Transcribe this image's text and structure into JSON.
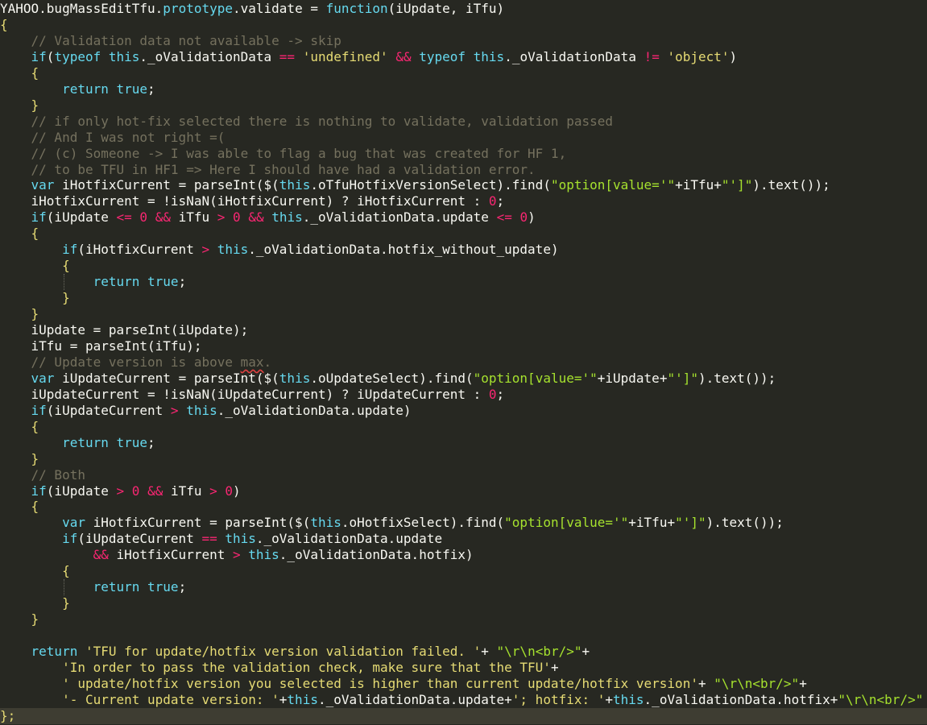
{
  "editor": {
    "lines": [
      {
        "tokens": [
          {
            "t": "YAHOO.bugMassEditTfu.",
            "c": "plain"
          },
          {
            "t": "prototype",
            "c": "proto"
          },
          {
            "t": ".validate = ",
            "c": "plain"
          },
          {
            "t": "function",
            "c": "kw"
          },
          {
            "t": "(iUpdate, iTfu)",
            "c": "plain"
          }
        ]
      },
      {
        "tokens": [
          {
            "t": "{",
            "c": "brace"
          }
        ]
      },
      {
        "tokens": [
          {
            "t": "    // Validation data not available -> skip",
            "c": "cmt"
          }
        ]
      },
      {
        "tokens": [
          {
            "t": "    ",
            "c": "plain"
          },
          {
            "t": "if",
            "c": "kw"
          },
          {
            "t": "(",
            "c": "plain"
          },
          {
            "t": "typeof",
            "c": "kw"
          },
          {
            "t": " ",
            "c": "plain"
          },
          {
            "t": "this",
            "c": "this"
          },
          {
            "t": "._oValidationData ",
            "c": "plain"
          },
          {
            "t": "==",
            "c": "op"
          },
          {
            "t": " ",
            "c": "plain"
          },
          {
            "t": "'undefined'",
            "c": "str"
          },
          {
            "t": " ",
            "c": "plain"
          },
          {
            "t": "&&",
            "c": "op"
          },
          {
            "t": " ",
            "c": "plain"
          },
          {
            "t": "typeof",
            "c": "kw"
          },
          {
            "t": " ",
            "c": "plain"
          },
          {
            "t": "this",
            "c": "this"
          },
          {
            "t": "._oValidationData ",
            "c": "plain"
          },
          {
            "t": "!=",
            "c": "op"
          },
          {
            "t": " ",
            "c": "plain"
          },
          {
            "t": "'object'",
            "c": "str"
          },
          {
            "t": ")",
            "c": "plain"
          }
        ]
      },
      {
        "tokens": [
          {
            "t": "    {",
            "c": "brace"
          }
        ]
      },
      {
        "tokens": [
          {
            "t": "        ",
            "c": "plain"
          },
          {
            "t": "return",
            "c": "kw"
          },
          {
            "t": " ",
            "c": "plain"
          },
          {
            "t": "true",
            "c": "kw"
          },
          {
            "t": ";",
            "c": "plain"
          }
        ]
      },
      {
        "tokens": [
          {
            "t": "    }",
            "c": "brace"
          }
        ]
      },
      {
        "tokens": [
          {
            "t": "    // if only hot-fix selected there is nothing to validate, validation passed",
            "c": "cmt"
          }
        ]
      },
      {
        "tokens": [
          {
            "t": "    // And I was not right =(",
            "c": "cmt"
          }
        ]
      },
      {
        "tokens": [
          {
            "t": "    // (c) Someone -> I was able to flag a bug that was created for HF 1,",
            "c": "cmt"
          }
        ]
      },
      {
        "tokens": [
          {
            "t": "    // to be TFU in HF1 => Here I should have had a validation error.",
            "c": "cmt"
          }
        ]
      },
      {
        "tokens": [
          {
            "t": "    ",
            "c": "plain"
          },
          {
            "t": "var",
            "c": "kw"
          },
          {
            "t": " iHotfixCurrent = parseInt($(",
            "c": "plain"
          },
          {
            "t": "this",
            "c": "this"
          },
          {
            "t": ".oTfuHotfixVersionSelect).find(",
            "c": "plain"
          },
          {
            "t": "\"option[value='\"",
            "c": "str-g"
          },
          {
            "t": "+iTfu+",
            "c": "plain"
          },
          {
            "t": "\"']\"",
            "c": "str-g"
          },
          {
            "t": ").text());",
            "c": "plain"
          }
        ]
      },
      {
        "tokens": [
          {
            "t": "    iHotfixCurrent = !isNaN(iHotfixCurrent) ? iHotfixCurrent : ",
            "c": "plain"
          },
          {
            "t": "0",
            "c": "num"
          },
          {
            "t": ";",
            "c": "plain"
          }
        ]
      },
      {
        "tokens": [
          {
            "t": "    ",
            "c": "plain"
          },
          {
            "t": "if",
            "c": "kw"
          },
          {
            "t": "(iUpdate ",
            "c": "plain"
          },
          {
            "t": "<=",
            "c": "op"
          },
          {
            "t": " ",
            "c": "plain"
          },
          {
            "t": "0",
            "c": "num"
          },
          {
            "t": " ",
            "c": "plain"
          },
          {
            "t": "&&",
            "c": "op"
          },
          {
            "t": " iTfu ",
            "c": "plain"
          },
          {
            "t": ">",
            "c": "op"
          },
          {
            "t": " ",
            "c": "plain"
          },
          {
            "t": "0",
            "c": "num"
          },
          {
            "t": " ",
            "c": "plain"
          },
          {
            "t": "&&",
            "c": "op"
          },
          {
            "t": " ",
            "c": "plain"
          },
          {
            "t": "this",
            "c": "this"
          },
          {
            "t": "._oValidationData.update ",
            "c": "plain"
          },
          {
            "t": "<=",
            "c": "op"
          },
          {
            "t": " ",
            "c": "plain"
          },
          {
            "t": "0",
            "c": "num"
          },
          {
            "t": ")",
            "c": "plain"
          }
        ]
      },
      {
        "tokens": [
          {
            "t": "    {",
            "c": "brace"
          }
        ]
      },
      {
        "tokens": [
          {
            "t": "        ",
            "c": "plain"
          },
          {
            "t": "if",
            "c": "kw"
          },
          {
            "t": "(iHotfixCurrent ",
            "c": "plain"
          },
          {
            "t": ">",
            "c": "op"
          },
          {
            "t": " ",
            "c": "plain"
          },
          {
            "t": "this",
            "c": "this"
          },
          {
            "t": "._oValidationData.hotfix_without_update)",
            "c": "plain"
          }
        ]
      },
      {
        "tokens": [
          {
            "t": "        {",
            "c": "brace"
          }
        ]
      },
      {
        "tokens": [
          {
            "t": "            ",
            "c": "plain"
          },
          {
            "t": "return",
            "c": "kw"
          },
          {
            "t": " ",
            "c": "plain"
          },
          {
            "t": "true",
            "c": "kw"
          },
          {
            "t": ";",
            "c": "plain"
          }
        ]
      },
      {
        "tokens": [
          {
            "t": "        }",
            "c": "brace"
          }
        ]
      },
      {
        "tokens": [
          {
            "t": "    }",
            "c": "brace"
          }
        ]
      },
      {
        "tokens": [
          {
            "t": "    iUpdate = parseInt(iUpdate);",
            "c": "plain"
          }
        ]
      },
      {
        "tokens": [
          {
            "t": "    iTfu = parseInt(iTfu);",
            "c": "plain"
          }
        ]
      },
      {
        "tokens": [
          {
            "t": "    // Update version is above ",
            "c": "cmt"
          },
          {
            "t": "max",
            "c": "cmt",
            "spell": true
          },
          {
            "t": ".",
            "c": "cmt"
          }
        ]
      },
      {
        "tokens": [
          {
            "t": "    ",
            "c": "plain"
          },
          {
            "t": "var",
            "c": "kw"
          },
          {
            "t": " iUpdateCurrent = parseInt($(",
            "c": "plain"
          },
          {
            "t": "this",
            "c": "this"
          },
          {
            "t": ".oUpdateSelect).find(",
            "c": "plain"
          },
          {
            "t": "\"option[value='\"",
            "c": "str-g"
          },
          {
            "t": "+iUpdate+",
            "c": "plain"
          },
          {
            "t": "\"']\"",
            "c": "str-g"
          },
          {
            "t": ").text());",
            "c": "plain"
          }
        ]
      },
      {
        "tokens": [
          {
            "t": "    iUpdateCurrent = !isNaN(iUpdateCurrent) ? iUpdateCurrent : ",
            "c": "plain"
          },
          {
            "t": "0",
            "c": "num"
          },
          {
            "t": ";",
            "c": "plain"
          }
        ]
      },
      {
        "tokens": [
          {
            "t": "    ",
            "c": "plain"
          },
          {
            "t": "if",
            "c": "kw"
          },
          {
            "t": "(iUpdateCurrent ",
            "c": "plain"
          },
          {
            "t": ">",
            "c": "op"
          },
          {
            "t": " ",
            "c": "plain"
          },
          {
            "t": "this",
            "c": "this"
          },
          {
            "t": "._oValidationData.update)",
            "c": "plain"
          }
        ]
      },
      {
        "tokens": [
          {
            "t": "    {",
            "c": "brace"
          }
        ]
      },
      {
        "tokens": [
          {
            "t": "        ",
            "c": "plain"
          },
          {
            "t": "return",
            "c": "kw"
          },
          {
            "t": " ",
            "c": "plain"
          },
          {
            "t": "true",
            "c": "kw"
          },
          {
            "t": ";",
            "c": "plain"
          }
        ]
      },
      {
        "tokens": [
          {
            "t": "    }",
            "c": "brace"
          }
        ]
      },
      {
        "tokens": [
          {
            "t": "    // Both",
            "c": "cmt"
          }
        ]
      },
      {
        "tokens": [
          {
            "t": "    ",
            "c": "plain"
          },
          {
            "t": "if",
            "c": "kw"
          },
          {
            "t": "(iUpdate ",
            "c": "plain"
          },
          {
            "t": ">",
            "c": "op"
          },
          {
            "t": " ",
            "c": "plain"
          },
          {
            "t": "0",
            "c": "num"
          },
          {
            "t": " ",
            "c": "plain"
          },
          {
            "t": "&&",
            "c": "op"
          },
          {
            "t": " iTfu ",
            "c": "plain"
          },
          {
            "t": ">",
            "c": "op"
          },
          {
            "t": " ",
            "c": "plain"
          },
          {
            "t": "0",
            "c": "num"
          },
          {
            "t": ")",
            "c": "plain"
          }
        ]
      },
      {
        "tokens": [
          {
            "t": "    {",
            "c": "brace"
          }
        ]
      },
      {
        "tokens": [
          {
            "t": "        ",
            "c": "plain"
          },
          {
            "t": "var",
            "c": "kw"
          },
          {
            "t": " iHotfixCurrent = parseInt($(",
            "c": "plain"
          },
          {
            "t": "this",
            "c": "this"
          },
          {
            "t": ".oHotfixSelect).find(",
            "c": "plain"
          },
          {
            "t": "\"option[value='\"",
            "c": "str-g"
          },
          {
            "t": "+iTfu+",
            "c": "plain"
          },
          {
            "t": "\"']\"",
            "c": "str-g"
          },
          {
            "t": ").text());",
            "c": "plain"
          }
        ]
      },
      {
        "tokens": [
          {
            "t": "        ",
            "c": "plain"
          },
          {
            "t": "if",
            "c": "kw"
          },
          {
            "t": "(iUpdateCurrent ",
            "c": "plain"
          },
          {
            "t": "==",
            "c": "op"
          },
          {
            "t": " ",
            "c": "plain"
          },
          {
            "t": "this",
            "c": "this"
          },
          {
            "t": "._oValidationData.update",
            "c": "plain"
          }
        ]
      },
      {
        "tokens": [
          {
            "t": "            ",
            "c": "plain"
          },
          {
            "t": "&&",
            "c": "op"
          },
          {
            "t": " iHotfixCurrent ",
            "c": "plain"
          },
          {
            "t": ">",
            "c": "op"
          },
          {
            "t": " ",
            "c": "plain"
          },
          {
            "t": "this",
            "c": "this"
          },
          {
            "t": "._oValidationData.hotfix)",
            "c": "plain"
          }
        ]
      },
      {
        "tokens": [
          {
            "t": "        {",
            "c": "brace"
          }
        ]
      },
      {
        "tokens": [
          {
            "t": "            ",
            "c": "plain"
          },
          {
            "t": "return",
            "c": "kw"
          },
          {
            "t": " ",
            "c": "plain"
          },
          {
            "t": "true",
            "c": "kw"
          },
          {
            "t": ";",
            "c": "plain"
          }
        ]
      },
      {
        "tokens": [
          {
            "t": "        }",
            "c": "brace"
          }
        ]
      },
      {
        "tokens": [
          {
            "t": "    }",
            "c": "brace"
          }
        ]
      },
      {
        "tokens": [
          {
            "t": "",
            "c": "plain"
          }
        ]
      },
      {
        "tokens": [
          {
            "t": "    ",
            "c": "plain"
          },
          {
            "t": "return",
            "c": "kw"
          },
          {
            "t": " ",
            "c": "plain"
          },
          {
            "t": "'TFU for update/hotfix version validation failed. '",
            "c": "str"
          },
          {
            "t": "+",
            "c": "plain"
          },
          {
            "t": " ",
            "c": "plain"
          },
          {
            "t": "\"\\r\\n<br/>\"",
            "c": "str-g"
          },
          {
            "t": "+",
            "c": "plain"
          }
        ]
      },
      {
        "tokens": [
          {
            "t": "        ",
            "c": "plain"
          },
          {
            "t": "'In order to pass the validation check, make sure that the TFU'",
            "c": "str"
          },
          {
            "t": "+",
            "c": "plain"
          }
        ]
      },
      {
        "tokens": [
          {
            "t": "        ",
            "c": "plain"
          },
          {
            "t": "' update/hotfix version you selected is higher than current update/hotfix version'",
            "c": "str"
          },
          {
            "t": "+ ",
            "c": "plain"
          },
          {
            "t": "\"\\r\\n<br/>\"",
            "c": "str-g"
          },
          {
            "t": "+",
            "c": "plain"
          }
        ]
      },
      {
        "tokens": [
          {
            "t": "        ",
            "c": "plain"
          },
          {
            "t": "'- Current update version: '",
            "c": "str"
          },
          {
            "t": "+",
            "c": "plain"
          },
          {
            "t": "this",
            "c": "this"
          },
          {
            "t": "._oValidationData.update+",
            "c": "plain"
          },
          {
            "t": "'; hotfix: '",
            "c": "str"
          },
          {
            "t": "+",
            "c": "plain"
          },
          {
            "t": "this",
            "c": "this"
          },
          {
            "t": "._oValidationData.hotfix+",
            "c": "plain"
          },
          {
            "t": "\"\\r\\n<br/>\"",
            "c": "str-g"
          }
        ]
      },
      {
        "tokens": [
          {
            "t": "};",
            "c": "brace"
          }
        ]
      }
    ],
    "highlighted_line": 44
  }
}
